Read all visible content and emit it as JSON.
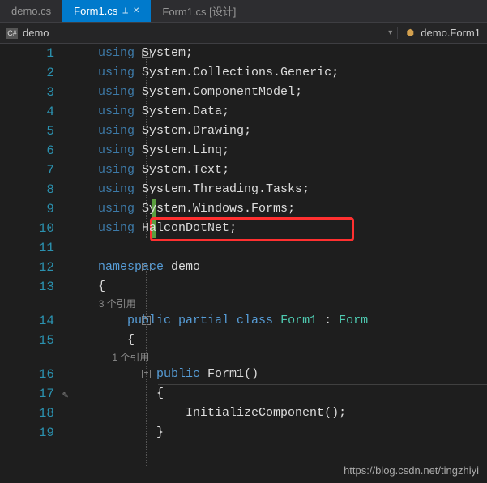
{
  "tabs": {
    "inactive1": "demo.cs",
    "active": "Form1.cs",
    "inactive2": "Form1.cs [设计]"
  },
  "breadcrumb": {
    "left_icon": "C#",
    "left": "demo",
    "right_icon": "⬢",
    "right": "demo.Form1"
  },
  "lines": {
    "l1": {
      "n": "1",
      "kw": "using ",
      "txt": "System",
      "end": ";"
    },
    "l2": {
      "n": "2",
      "kw": "using ",
      "txt": "System.Collections.Generic",
      "end": ";"
    },
    "l3": {
      "n": "3",
      "kw": "using ",
      "txt": "System.ComponentModel",
      "end": ";"
    },
    "l4": {
      "n": "4",
      "kw": "using ",
      "txt": "System.Data",
      "end": ";"
    },
    "l5": {
      "n": "5",
      "kw": "using ",
      "txt": "System.Drawing",
      "end": ";"
    },
    "l6": {
      "n": "6",
      "kw": "using ",
      "txt": "System.Linq",
      "end": ";"
    },
    "l7": {
      "n": "7",
      "kw": "using ",
      "txt": "System.Text",
      "end": ";"
    },
    "l8": {
      "n": "8",
      "kw": "using ",
      "txt": "System.Threading.Tasks",
      "end": ";"
    },
    "l9": {
      "n": "9",
      "kw": "using ",
      "txt": "System.Windows.Forms",
      "end": ";"
    },
    "l10": {
      "n": "10",
      "kw": "using ",
      "txt": "HalconDotNet",
      "end": ";"
    },
    "l11": {
      "n": "11"
    },
    "l12": {
      "n": "12",
      "kw": "namespace ",
      "txt": "demo"
    },
    "l13": {
      "n": "13",
      "brace": "{"
    },
    "ref1": "3 个引用",
    "l14": {
      "n": "14",
      "kw1": "public ",
      "kw2": "partial ",
      "kw3": "class ",
      "cls": "Form1",
      "colon": " : ",
      "base": "Form"
    },
    "l15": {
      "n": "15",
      "brace": "{"
    },
    "ref2": "1 个引用",
    "l16": {
      "n": "16",
      "kw": "public ",
      "method": "Form1",
      "paren": "()"
    },
    "l17": {
      "n": "17",
      "brace": "{"
    },
    "l18": {
      "n": "18",
      "call": "InitializeComponent",
      "paren": "();"
    },
    "l19": {
      "n": "19",
      "brace": "}"
    }
  },
  "watermark": "https://blog.csdn.net/tingzhiyi"
}
